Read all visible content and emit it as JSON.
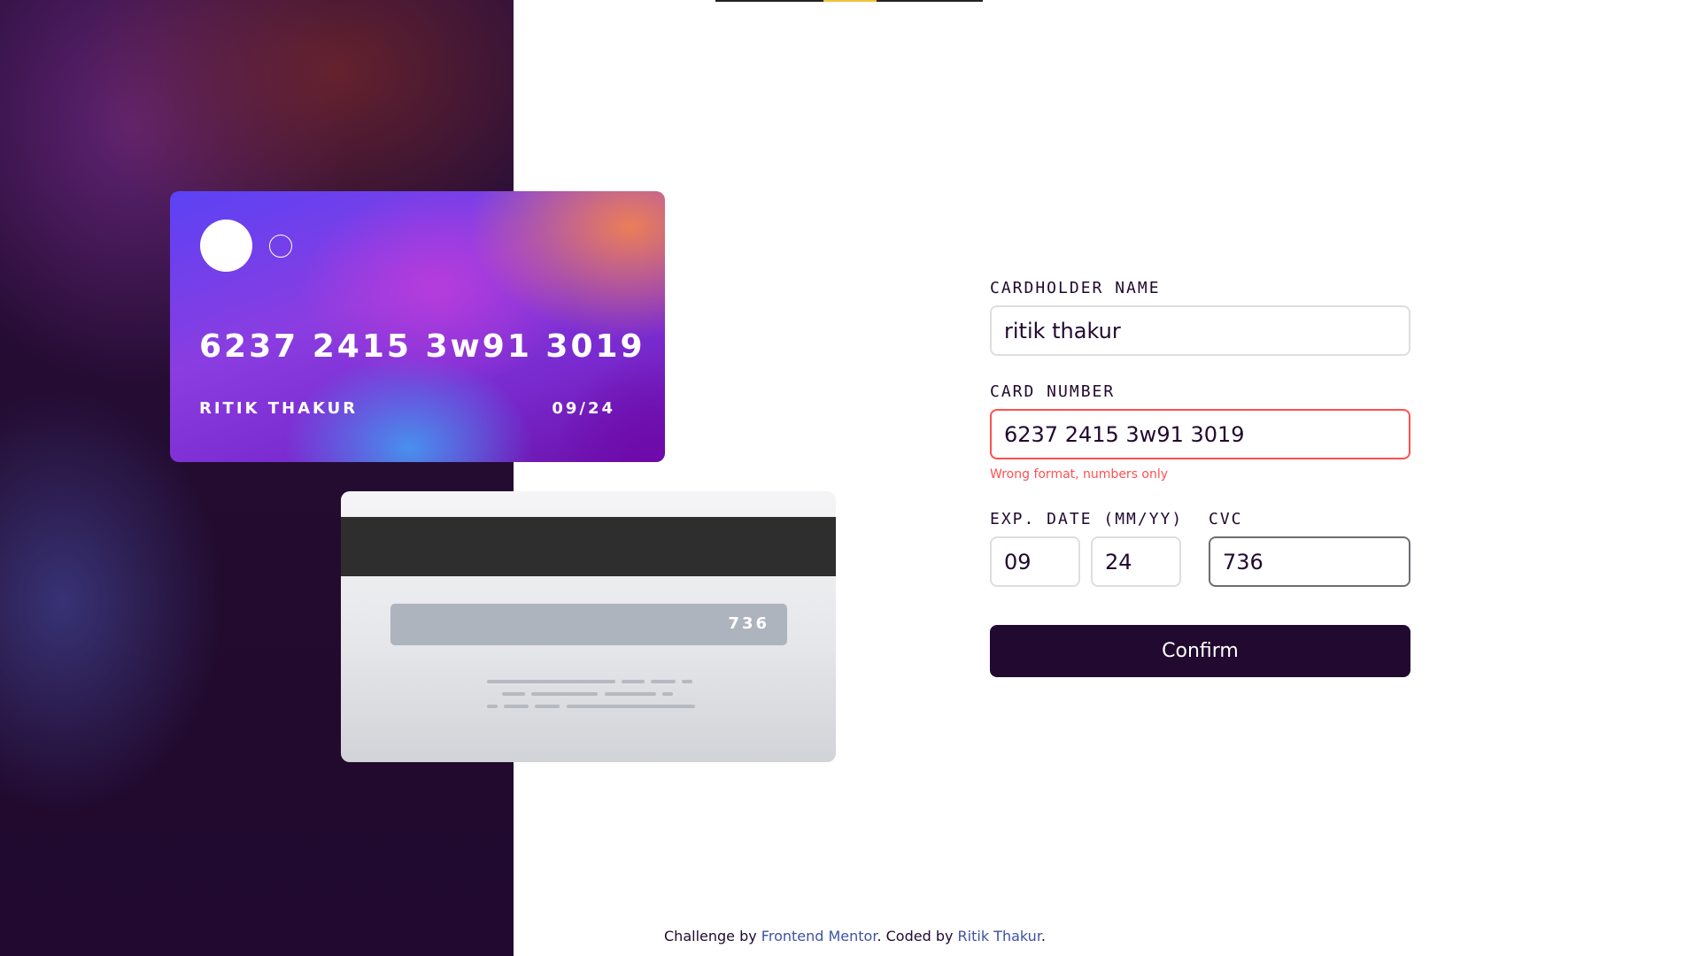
{
  "card_front": {
    "number": "6237 2415 3w91 3019",
    "name": "RITIK THAKUR",
    "expiry": "09/24"
  },
  "card_back": {
    "cvc": "736"
  },
  "form": {
    "cardholder": {
      "label": "CARDHOLDER NAME",
      "value": "ritik thakur"
    },
    "number": {
      "label": "CARD NUMBER",
      "value": "6237 2415 3w91 3019",
      "error": "Wrong format, numbers only"
    },
    "expiry": {
      "label": "EXP. DATE (MM/YY)",
      "month": "09",
      "year": "24"
    },
    "cvc": {
      "label": "CVC",
      "value": "736"
    },
    "confirm_label": "Confirm"
  },
  "footer": {
    "prefix": "Challenge by ",
    "link1": "Frontend Mentor",
    "middle": ". Coded by ",
    "link2": "Ritik Thakur",
    "suffix": "."
  },
  "colors": {
    "dark_violet": "#21092f",
    "error_red": "#ff5050",
    "accent_yellow": "#f0c23a"
  }
}
